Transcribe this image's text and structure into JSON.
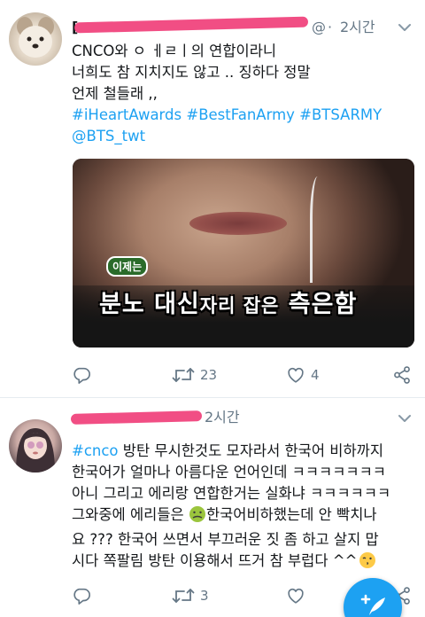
{
  "tweets": [
    {
      "time": "2시간",
      "username_fragment": "[",
      "handle_fragment": "@",
      "lines": [
        "CNCO와 ㅇ ㅔㄹㅣ의 연합이라니",
        "너희도 참 지치지도 않고 .. 징하다 정말",
        "언제 철들래 ,,"
      ],
      "hashtags": [
        "#iHeartAwards",
        "#BestFanArmy",
        "#BTSARMY"
      ],
      "mention": "@BTS_twt",
      "image": {
        "caption_top": "이제는",
        "caption_big_1": "분노 대신",
        "caption_small": "자리 잡은",
        "caption_big_2": "측은함"
      },
      "actions": {
        "retweets": "23",
        "likes": "4"
      }
    },
    {
      "time": "2시간",
      "text_hashtag": "#cnco",
      "lines": [
        "방탄 무시한것도 모자라서 한국어 비하까지",
        "한국어가 얼마나 아름다운 언어인데 ㅋㅋㅋㅋㅋㅋㅋ",
        "아니 그리고 에리랑 연합한거는 실화냐 ㅋㅋㅋㅋㅋㅋ",
        "그와중에 에리들은",
        "한국어비하했는데 안 빡치나",
        "요 ???  한국어 쓰면서 부끄러운 짓 좀 하고 살지 맙",
        "시다 쪽팔림 방탄 이용해서 뜨거 참 부럽다 ^^"
      ],
      "actions": {
        "retweets": "3"
      }
    }
  ],
  "colors": {
    "link": "#1da1f2",
    "text": "#14171a",
    "meta": "#657786",
    "redaction": "#f0447d",
    "fab": "#1da1f2"
  },
  "icons": [
    "chevron-down-icon",
    "reply-icon",
    "retweet-icon",
    "like-icon",
    "share-icon",
    "compose-icon",
    "nauseated-face-emoji",
    "kissing-face-emoji"
  ]
}
